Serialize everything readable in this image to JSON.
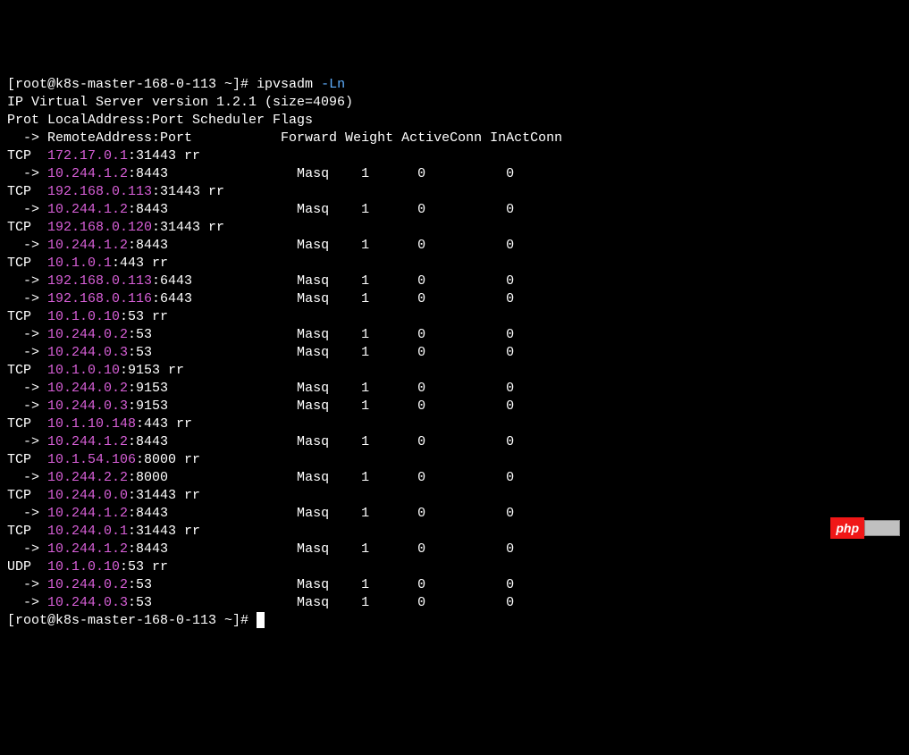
{
  "prompt1": {
    "prefix": "[root@k8s-master-168-0-113 ~]# ",
    "command": "ipvsadm",
    "flag": " -Ln"
  },
  "version_line": "IP Virtual Server version 1.2.1 (size=4096)",
  "header1": "Prot LocalAddress:Port Scheduler Flags",
  "header2": "  -> RemoteAddress:Port           Forward Weight ActiveConn InActConn",
  "services": [
    {
      "prot": "TCP",
      "local_ip": "172.17.0.1",
      "local_suffix": ":31443 rr",
      "remotes": [
        {
          "arrow": "  -> ",
          "ip": "10.244.1.2",
          "suffix": ":8443                Masq    1      0          0"
        }
      ]
    },
    {
      "prot": "TCP",
      "local_ip": "192.168.0.113",
      "local_suffix": ":31443 rr",
      "remotes": [
        {
          "arrow": "  -> ",
          "ip": "10.244.1.2",
          "suffix": ":8443                Masq    1      0          0"
        }
      ]
    },
    {
      "prot": "TCP",
      "local_ip": "192.168.0.120",
      "local_suffix": ":31443 rr",
      "remotes": [
        {
          "arrow": "  -> ",
          "ip": "10.244.1.2",
          "suffix": ":8443                Masq    1      0          0"
        }
      ]
    },
    {
      "prot": "TCP",
      "local_ip": "10.1.0.1",
      "local_suffix": ":443 rr",
      "remotes": [
        {
          "arrow": "  -> ",
          "ip": "192.168.0.113",
          "suffix": ":6443             Masq    1      0          0"
        },
        {
          "arrow": "  -> ",
          "ip": "192.168.0.116",
          "suffix": ":6443             Masq    1      0          0"
        }
      ]
    },
    {
      "prot": "TCP",
      "local_ip": "10.1.0.10",
      "local_suffix": ":53 rr",
      "remotes": [
        {
          "arrow": "  -> ",
          "ip": "10.244.0.2",
          "suffix": ":53                  Masq    1      0          0"
        },
        {
          "arrow": "  -> ",
          "ip": "10.244.0.3",
          "suffix": ":53                  Masq    1      0          0"
        }
      ]
    },
    {
      "prot": "TCP",
      "local_ip": "10.1.0.10",
      "local_suffix": ":9153 rr",
      "remotes": [
        {
          "arrow": "  -> ",
          "ip": "10.244.0.2",
          "suffix": ":9153                Masq    1      0          0"
        },
        {
          "arrow": "  -> ",
          "ip": "10.244.0.3",
          "suffix": ":9153                Masq    1      0          0"
        }
      ]
    },
    {
      "prot": "TCP",
      "local_ip": "10.1.10.148",
      "local_suffix": ":443 rr",
      "remotes": [
        {
          "arrow": "  -> ",
          "ip": "10.244.1.2",
          "suffix": ":8443                Masq    1      0          0"
        }
      ]
    },
    {
      "prot": "TCP",
      "local_ip": "10.1.54.106",
      "local_suffix": ":8000 rr",
      "remotes": [
        {
          "arrow": "  -> ",
          "ip": "10.244.2.2",
          "suffix": ":8000                Masq    1      0          0"
        }
      ]
    },
    {
      "prot": "TCP",
      "local_ip": "10.244.0.0",
      "local_suffix": ":31443 rr",
      "remotes": [
        {
          "arrow": "  -> ",
          "ip": "10.244.1.2",
          "suffix": ":8443                Masq    1      0          0"
        }
      ]
    },
    {
      "prot": "TCP",
      "local_ip": "10.244.0.1",
      "local_suffix": ":31443 rr",
      "remotes": [
        {
          "arrow": "  -> ",
          "ip": "10.244.1.2",
          "suffix": ":8443                Masq    1      0          0"
        }
      ]
    },
    {
      "prot": "UDP",
      "local_ip": "10.1.0.10",
      "local_suffix": ":53 rr",
      "remotes": [
        {
          "arrow": "  -> ",
          "ip": "10.244.0.2",
          "suffix": ":53                  Masq    1      0          0"
        },
        {
          "arrow": "  -> ",
          "ip": "10.244.0.3",
          "suffix": ":53                  Masq    1      0          0"
        }
      ]
    }
  ],
  "prompt2": {
    "prefix": "[root@k8s-master-168-0-113 ~]# "
  },
  "watermark": {
    "text": "php"
  }
}
